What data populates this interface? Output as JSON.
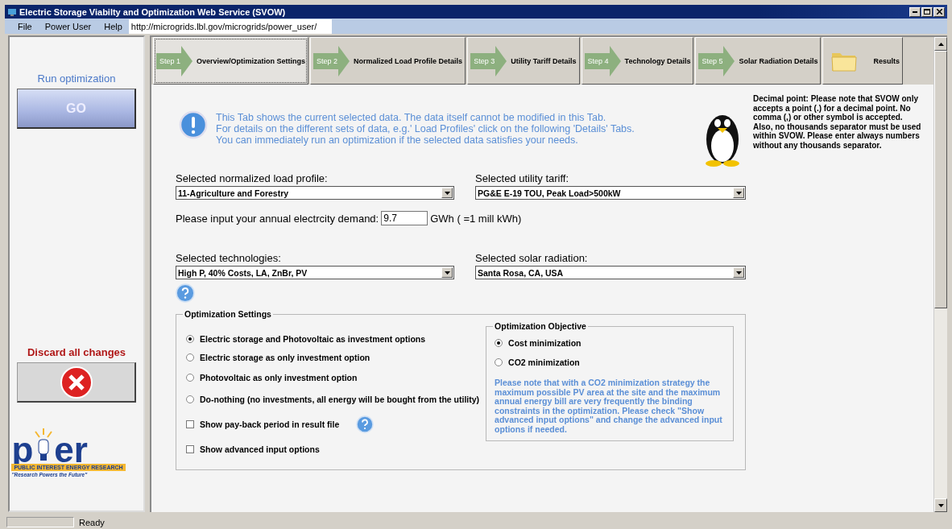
{
  "window": {
    "title": "Electric Storage Viabilty and Optimization Web Service (SVOW)"
  },
  "menu": [
    {
      "label": "File"
    },
    {
      "label": "Power User"
    },
    {
      "label": "Help"
    }
  ],
  "address": {
    "value": "http://microgrids.lbl.gov/microgrids/power_user/"
  },
  "sidebar": {
    "run_label": "Run optimization",
    "go_button": "GO",
    "discard_label": "Discard all changes",
    "logo": {
      "left": "p",
      "right": "er",
      "band": "PUBLIC INTEREST ENERGY RESEARCH",
      "slogan": "\"Research Powers the Future\""
    }
  },
  "tabs": [
    {
      "kind": "step",
      "step": "Step 1",
      "label": "Overview/Optimization Settings",
      "selected": true
    },
    {
      "kind": "step",
      "step": "Step 2",
      "label": "Normalized Load Profile Details",
      "selected": false
    },
    {
      "kind": "step",
      "step": "Step 3",
      "label": "Utility Tariff Details",
      "selected": false
    },
    {
      "kind": "step",
      "step": "Step 4",
      "label": "Technology Details",
      "selected": false
    },
    {
      "kind": "step",
      "step": "Step 5",
      "label": "Solar Radiation Details",
      "selected": false
    },
    {
      "kind": "folder",
      "label": "Results",
      "selected": false
    }
  ],
  "info": [
    "This Tab shows the current selected data. The data itself cannot be modified in this Tab.",
    "For details on the different sets of data, e.g.' Load Profiles' click on the following 'Details' Tabs.",
    "You can immediately run an optimization if the selected data satisfies your needs."
  ],
  "note": "Decimal point: Please note that SVOW only accepts a point (.) for a decimal point. No comma (,) or other symbol is accepted.\nAlso, no thousands separator must be used within SVOW. Please enter always numbers without any thousands separator.",
  "load_profile": {
    "label": "Selected normalized load profile:",
    "value": "11-Agriculture and Forestry"
  },
  "tariff": {
    "label": "Selected utility tariff:",
    "value": "PG&E E-19 TOU, Peak Load>500kW"
  },
  "demand": {
    "label": "Please input your annual electrcity demand:",
    "value": "9.7",
    "unit": "GWh ( =1 mill kWh)"
  },
  "technologies": {
    "label": "Selected technologies:",
    "value": "High P, 40% Costs, LA, ZnBr, PV"
  },
  "solar": {
    "label": "Selected solar radiation:",
    "value": "Santa Rosa, CA, USA"
  },
  "settings": {
    "title": "Optimization Settings",
    "options": [
      {
        "kind": "radio",
        "label": "Electric storage and Photovoltaic as investment options",
        "selected": true
      },
      {
        "kind": "radio",
        "label": "Electric storage as only investment option",
        "selected": false
      },
      {
        "kind": "radio",
        "label": "Photovoltaic as only investment option",
        "selected": false
      },
      {
        "kind": "radio",
        "label": "Do-nothing (no investments, all energy will be bought from the utility)",
        "selected": false
      },
      {
        "kind": "checkbox",
        "label": "Show pay-back period in result file",
        "checked": false,
        "help": true
      },
      {
        "kind": "checkbox",
        "label": "Show advanced input options",
        "checked": false,
        "help": false
      }
    ]
  },
  "objective": {
    "title": "Optimization Objective",
    "options": [
      {
        "label": "Cost minimization",
        "selected": true
      },
      {
        "label": "CO2 minimization",
        "selected": false
      }
    ],
    "note": "Please note that with a CO2 minimization strategy the maximum possible PV area at the site and the maximum annual energy bill are very frequently the binding constraints in the optimization. Please check \"Show advanced input options\" and change the advanced input options if needed."
  },
  "status_bar": {
    "text": "Ready"
  }
}
